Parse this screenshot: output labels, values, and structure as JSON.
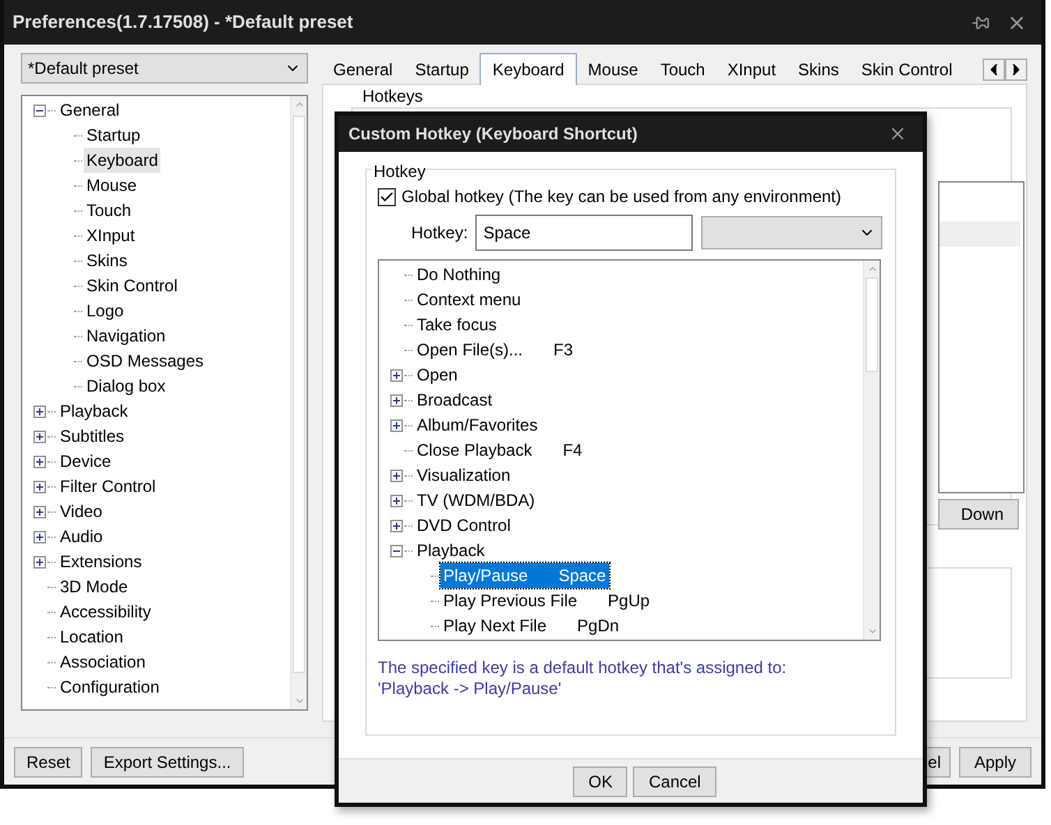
{
  "window": {
    "title": "Preferences(1.7.17508) - *Default preset"
  },
  "preset_select": {
    "value": "*Default preset"
  },
  "tree": [
    {
      "label": "General",
      "expanded": true,
      "selected": false,
      "children": [
        {
          "label": "Startup",
          "selected": false
        },
        {
          "label": "Keyboard",
          "selected": true
        },
        {
          "label": "Mouse",
          "selected": false
        },
        {
          "label": "Touch",
          "selected": false
        },
        {
          "label": "XInput",
          "selected": false
        },
        {
          "label": "Skins",
          "selected": false
        },
        {
          "label": "Skin Control",
          "selected": false
        },
        {
          "label": "Logo",
          "selected": false
        },
        {
          "label": "Navigation",
          "selected": false
        },
        {
          "label": "OSD Messages",
          "selected": false
        },
        {
          "label": "Dialog box",
          "selected": false
        }
      ]
    },
    {
      "label": "Playback",
      "expanded": false,
      "selected": false
    },
    {
      "label": "Subtitles",
      "expanded": false,
      "selected": false
    },
    {
      "label": "Device",
      "expanded": false,
      "selected": false
    },
    {
      "label": "Filter Control",
      "expanded": false,
      "selected": false
    },
    {
      "label": "Video",
      "expanded": false,
      "selected": false
    },
    {
      "label": "Audio",
      "expanded": false,
      "selected": false
    },
    {
      "label": "Extensions",
      "expanded": false,
      "selected": false
    },
    {
      "label": "3D Mode",
      "selected": false
    },
    {
      "label": "Accessibility",
      "selected": false
    },
    {
      "label": "Location",
      "selected": false
    },
    {
      "label": "Association",
      "selected": false
    },
    {
      "label": "Configuration",
      "selected": false
    }
  ],
  "tabs": [
    {
      "label": "General",
      "selected": false
    },
    {
      "label": "Startup",
      "selected": false
    },
    {
      "label": "Keyboard",
      "selected": true
    },
    {
      "label": "Mouse",
      "selected": false
    },
    {
      "label": "Touch",
      "selected": false
    },
    {
      "label": "XInput",
      "selected": false
    },
    {
      "label": "Skins",
      "selected": false
    },
    {
      "label": "Skin Control",
      "selected": false
    }
  ],
  "hotkeys_group": {
    "label": "Hotkeys",
    "down_button": "Down"
  },
  "footer_buttons": {
    "reset": "Reset",
    "export": "Export Settings...",
    "cancel_visible": "el",
    "apply": "Apply"
  },
  "dialog": {
    "title": "Custom Hotkey (Keyboard Shortcut)",
    "group_label": "Hotkey",
    "global_hotkey": {
      "label": "Global hotkey (The key can be used from any environment)",
      "checked": true
    },
    "hotkey_label": "Hotkey:",
    "hotkey_value": "Space",
    "commands": [
      {
        "label": "Do Nothing",
        "selected": false
      },
      {
        "label": "Context menu",
        "selected": false
      },
      {
        "label": "Take focus",
        "selected": false
      },
      {
        "label": "Open File(s)...",
        "shortcut": "F3",
        "selected": false
      },
      {
        "label": "Open",
        "expanded": false,
        "selected": false
      },
      {
        "label": "Broadcast",
        "expanded": false,
        "selected": false
      },
      {
        "label": "Album/Favorites",
        "expanded": false,
        "selected": false
      },
      {
        "label": "Close Playback",
        "shortcut": "F4",
        "selected": false
      },
      {
        "label": "Visualization",
        "expanded": false,
        "selected": false
      },
      {
        "label": "TV (WDM/BDA)",
        "expanded": false,
        "selected": false
      },
      {
        "label": "DVD Control",
        "expanded": false,
        "selected": false
      },
      {
        "label": "Playback",
        "expanded": true,
        "selected": false,
        "children": [
          {
            "label": "Play/Pause",
            "shortcut": "Space",
            "selected": true
          },
          {
            "label": "Play Previous File",
            "shortcut": "PgUp",
            "selected": false
          },
          {
            "label": "Play Next File",
            "shortcut": "PgDn",
            "selected": false
          }
        ]
      }
    ],
    "info": "The specified key is a default hotkey that's assigned to: 'Playback -> Play/Pause'",
    "buttons": [
      "OK",
      "Cancel"
    ]
  }
}
